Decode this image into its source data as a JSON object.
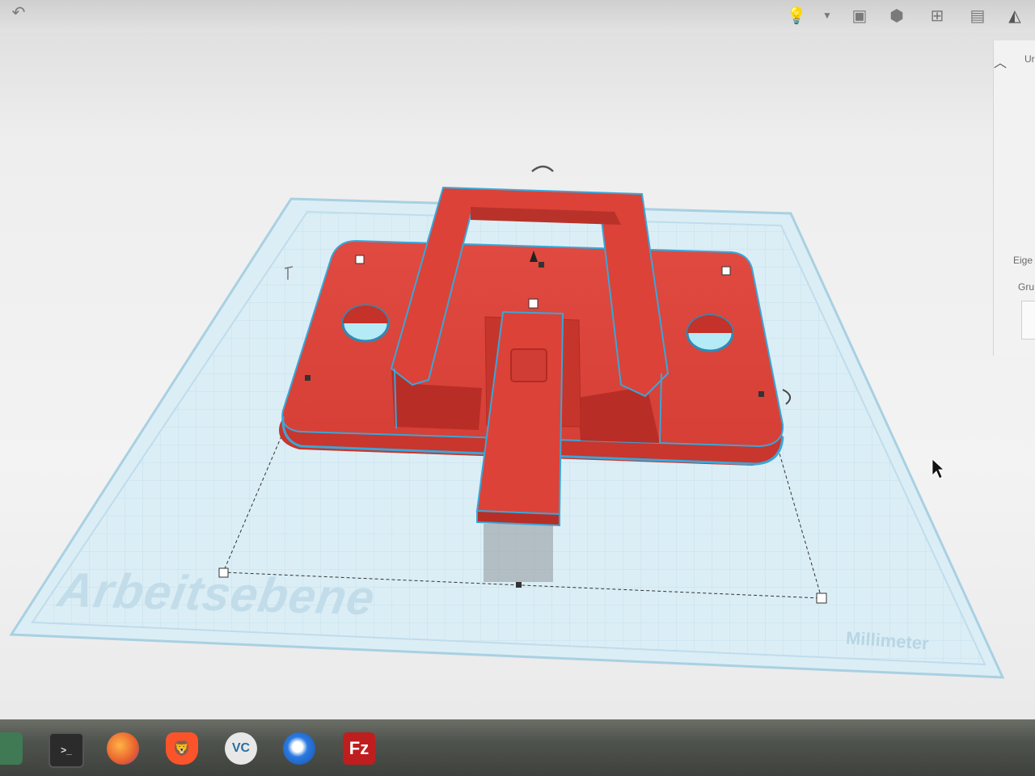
{
  "workplane": {
    "label": "Arbeitsebene",
    "unit": "Millimeter"
  },
  "inspector": {
    "section_title": "Ur",
    "properties_label": "Eige",
    "group_label": "Gru"
  },
  "toolbar": {
    "icons": [
      "light-bulb-icon",
      "dropdown-caret-icon",
      "group-icon",
      "ungroup-icon",
      "align-icon",
      "flip-icon",
      "mirror-icon"
    ]
  },
  "taskbar": {
    "apps": [
      "terminal",
      "firefox",
      "brave",
      "vscodium",
      "thunderbird",
      "filezilla"
    ],
    "filezilla_label": "Fz",
    "vc_label": "VC"
  },
  "colors": {
    "model": "#d8433a",
    "model_dark": "#b83129",
    "selection_outline": "#3aa6d8",
    "workplane": "#dbeef6",
    "grid": "#bfdcea"
  }
}
